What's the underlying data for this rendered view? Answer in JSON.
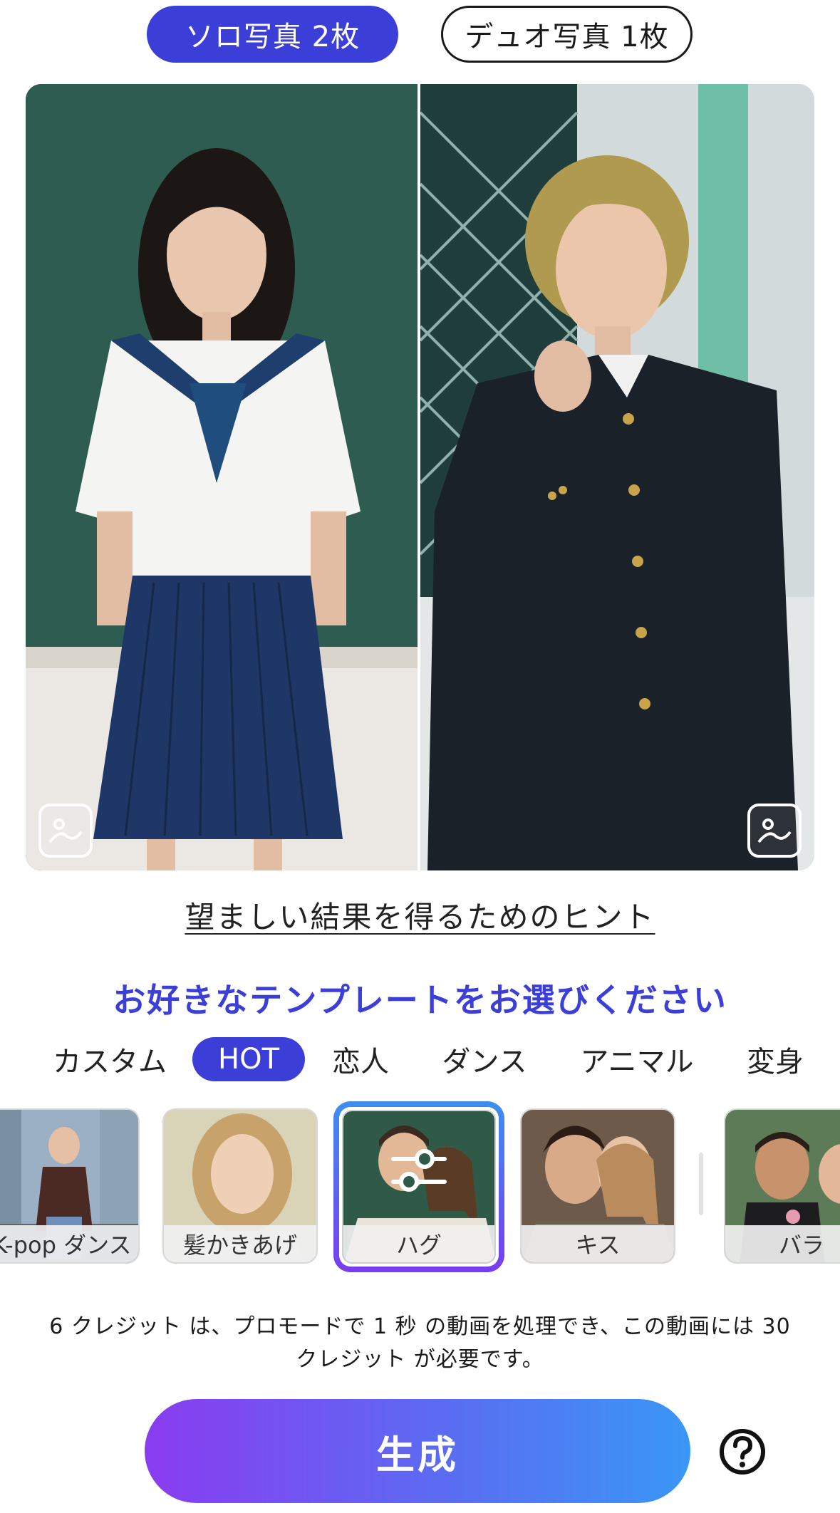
{
  "mode_toggle": {
    "solo_label": "ソロ写真 2枚",
    "duo_label": "デュオ写真 1枚",
    "selected": "solo"
  },
  "photos": [
    {
      "icon": "gallery-icon"
    },
    {
      "icon": "gallery-icon"
    }
  ],
  "hint_link": "望ましい結果を得るためのヒント",
  "section_title": "お好きなテンプレートをお選びください",
  "tabs": [
    {
      "label": "カスタム"
    },
    {
      "label": "HOT"
    },
    {
      "label": "恋人"
    },
    {
      "label": "ダンス"
    },
    {
      "label": "アニマル"
    },
    {
      "label": "変身"
    }
  ],
  "active_tab": "HOT",
  "templates": [
    {
      "label": "K-pop ダンス"
    },
    {
      "label": "髪かきあげ"
    },
    {
      "label": "ハグ"
    },
    {
      "label": "キス"
    },
    {
      "label": "バラ"
    }
  ],
  "selected_template": "ハグ",
  "credit_note": {
    "line1": "6 クレジット は、プロモードで 1 秒 の動画を処理でき、この動画には 30",
    "line2": "クレジット が必要です。"
  },
  "generate_button": "生成",
  "colors": {
    "accent": "#3b3fd8",
    "gradient_start": "#8a3cf0",
    "gradient_end": "#3a97f5"
  }
}
